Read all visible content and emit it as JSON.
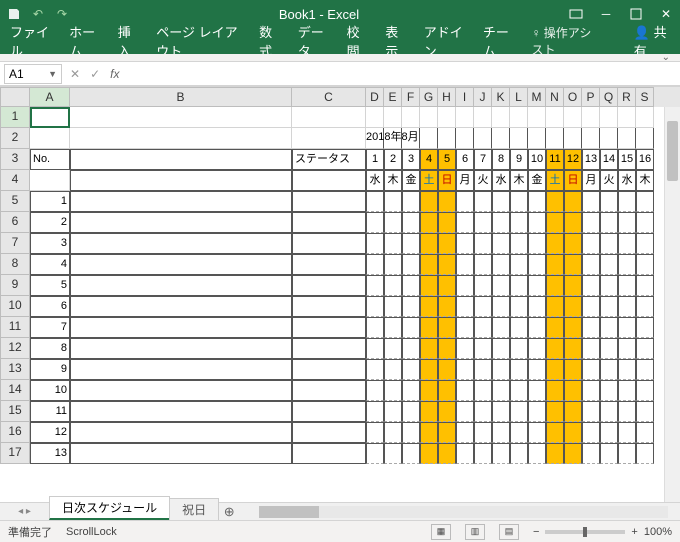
{
  "title": "Book1 - Excel",
  "ribbon": {
    "tabs": [
      "ファイル",
      "ホーム",
      "挿入",
      "ページ レイアウト",
      "数式",
      "データ",
      "校閲",
      "表示",
      "アドイン",
      "チーム"
    ],
    "tell_me": "操作アシスト",
    "share": "共有"
  },
  "namebox": "A1",
  "columns": [
    "A",
    "B",
    "C",
    "D",
    "E",
    "F",
    "G",
    "H",
    "I",
    "J",
    "K",
    "L",
    "M",
    "N",
    "O",
    "P",
    "Q",
    "R",
    "S"
  ],
  "row_headers": [
    "1",
    "2",
    "3",
    "4",
    "5",
    "6",
    "7",
    "8",
    "9",
    "10",
    "11",
    "12",
    "13",
    "14",
    "15",
    "16",
    "17"
  ],
  "sheet": {
    "month_label": "2018年8月",
    "header_no": "No.",
    "header_status": "ステータス",
    "days": [
      "1",
      "2",
      "3",
      "4",
      "5",
      "6",
      "7",
      "8",
      "9",
      "10",
      "11",
      "12",
      "13",
      "14",
      "15",
      "16"
    ],
    "weekdays": [
      "水",
      "木",
      "金",
      "土",
      "日",
      "月",
      "火",
      "水",
      "木",
      "金",
      "土",
      "日",
      "月",
      "火",
      "水",
      "木"
    ],
    "weekend_cols": [
      3,
      4,
      10,
      11
    ],
    "numbers": [
      "1",
      "2",
      "3",
      "4",
      "5",
      "6",
      "7",
      "8",
      "9",
      "10",
      "11",
      "12",
      "13"
    ]
  },
  "tabs": {
    "active": "日次スケジュール",
    "other": "祝日"
  },
  "status": {
    "ready": "準備完了",
    "scroll": "ScrollLock",
    "zoom": "100%"
  }
}
